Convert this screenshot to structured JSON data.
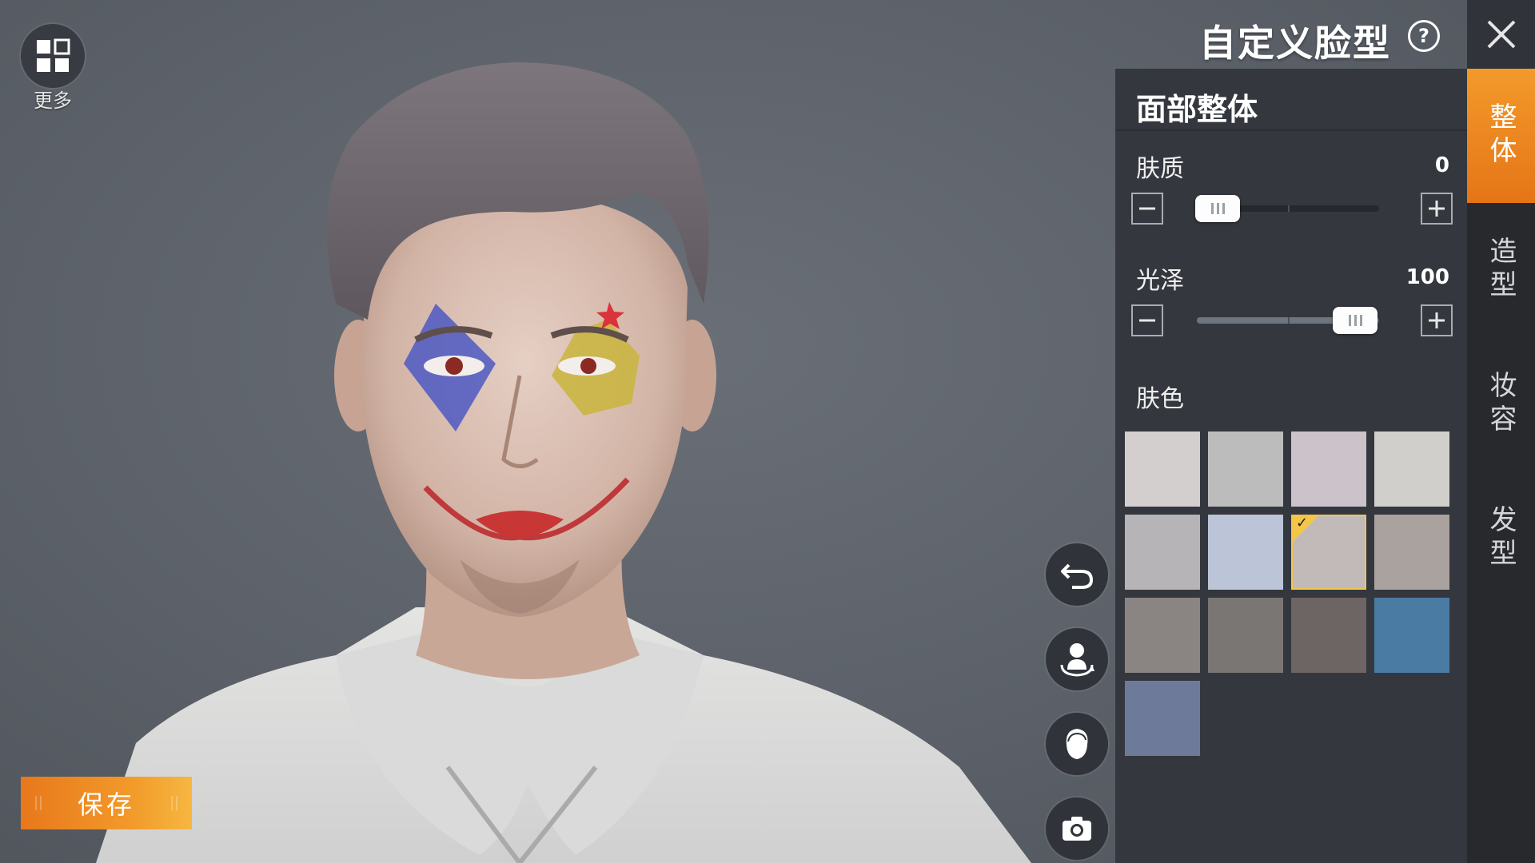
{
  "header": {
    "title": "自定义脸型",
    "help_icon": "question-mark-icon",
    "close_icon": "close-icon"
  },
  "more": {
    "label": "更多",
    "icon": "grid-icon"
  },
  "save": {
    "label": "保存"
  },
  "actions": [
    {
      "name": "undo",
      "icon": "undo-icon"
    },
    {
      "name": "rotate-character",
      "icon": "rotate-person-icon"
    },
    {
      "name": "hair-view",
      "icon": "head-hair-icon"
    },
    {
      "name": "screenshot",
      "icon": "camera-icon"
    }
  ],
  "panel": {
    "title": "面部整体",
    "sliders": [
      {
        "label": "肤质",
        "value": "0",
        "level": 0
      },
      {
        "label": "光泽",
        "value": "100",
        "level": 1
      }
    ],
    "skin_color": {
      "label": "肤色",
      "selected_index": 6,
      "colors": [
        "#d3cfcf",
        "#bcbcbd",
        "#cbc3c9",
        "#d1cfcc",
        "#b6b4b7",
        "#bcc4d8",
        "#c1bab9",
        "#a9a29e",
        "#8a8582",
        "#7a7673",
        "#6d6564",
        "#4a7ba3",
        "#6d7a9a"
      ]
    }
  },
  "tabs": [
    {
      "label": "整体",
      "active": true
    },
    {
      "label": "造型",
      "active": false
    },
    {
      "label": "妆容",
      "active": false
    },
    {
      "label": "发型",
      "active": false
    }
  ],
  "colors": {
    "accent": "#f08a22",
    "panel": "#34383e",
    "tabbar": "#27292d"
  }
}
